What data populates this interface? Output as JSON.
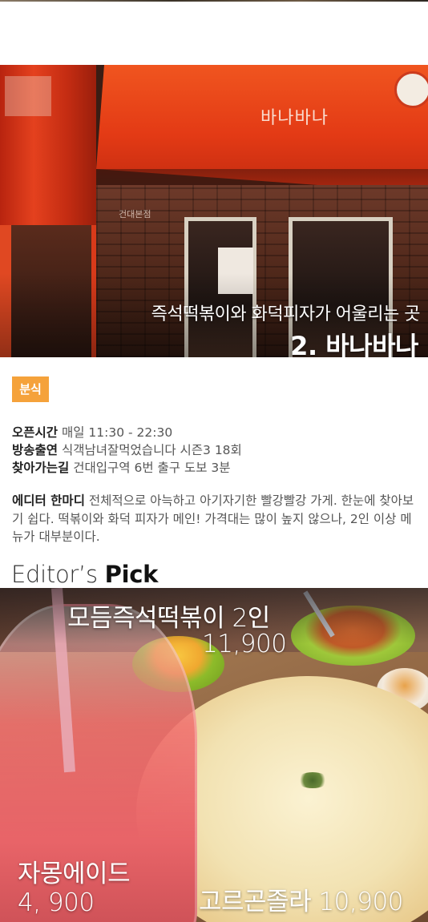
{
  "hero": {
    "subtitle": "즉석떡볶이와 화덕피자가 어울리는 곳",
    "title": "2. 바나바나",
    "awning_logo": "바나바나",
    "store_sign": "건대본점"
  },
  "category_badge": "분식",
  "info": {
    "hours_label": "오픈시간",
    "hours_value": "매일 11:30 - 22:30",
    "tv_label": "방송출연",
    "tv_value": "식객남녀잘먹었습니다 시즌3 18회",
    "directions_label": "찾아가는길",
    "directions_value": "건대입구역 6번 출구 도보 3분"
  },
  "editor_note": {
    "label": "에디터 한마디",
    "text": "전체적으로 아늑하고 아기자기한 빨강빨강 가게. 한눈에 찾아보기 쉽다. 떡볶이와 화덕 피자가 메인! 가격대는 많이 높지 않으나, 2인 이상 메뉴가 대부분이다."
  },
  "pick": {
    "heading_prefix": "Editor’s ",
    "heading_bold": "Pick",
    "items": [
      {
        "name": "모듬즉석떡볶이 2인",
        "price": "11,900"
      },
      {
        "name": "자몽에이드",
        "price": "4, 900"
      },
      {
        "name": "고르곤졸라 10,900"
      }
    ]
  },
  "colors": {
    "badge": "#f5a23b",
    "awning": "#e33a15"
  }
}
